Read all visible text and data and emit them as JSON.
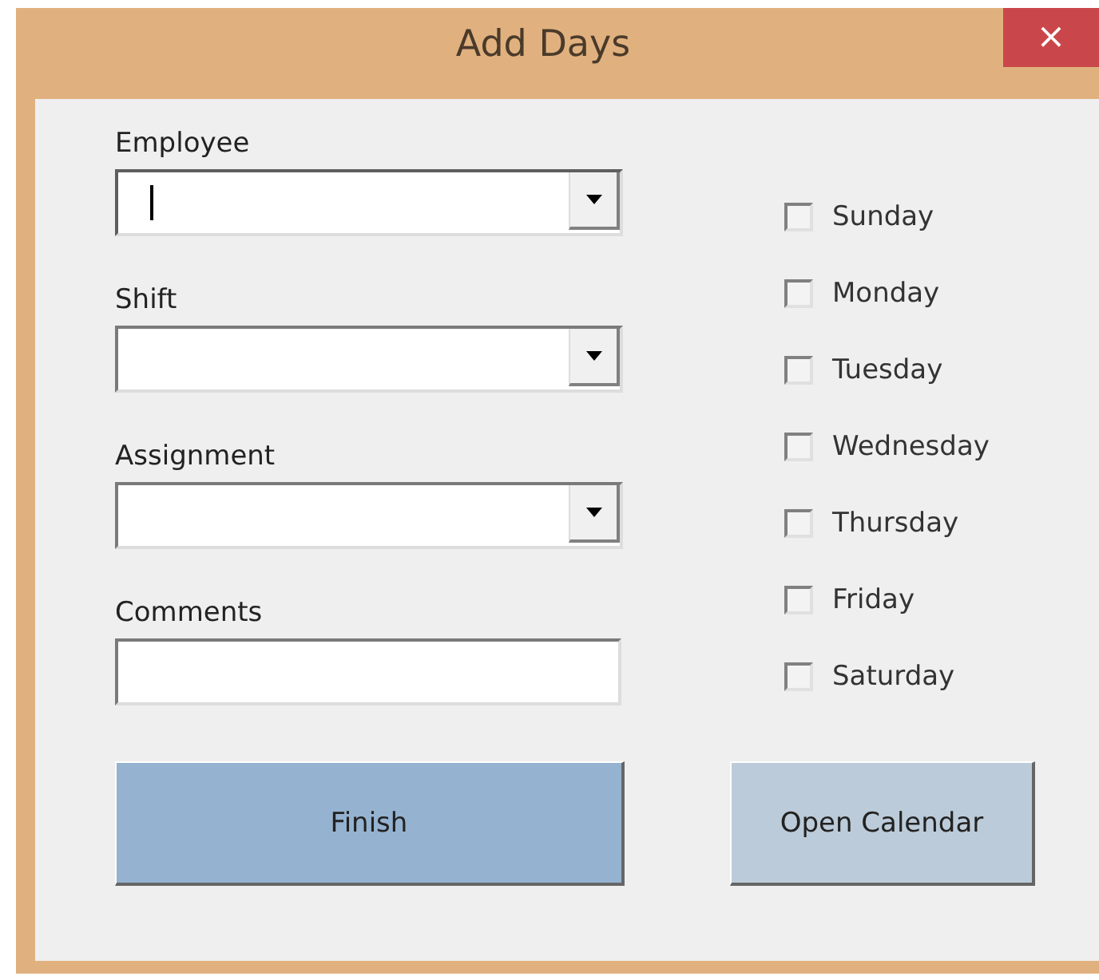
{
  "window": {
    "title": "Add Days",
    "close": "×"
  },
  "fields": [
    {
      "label": "Employee",
      "kind": "combo",
      "focused": true
    },
    {
      "label": "Shift",
      "kind": "combo",
      "focused": false
    },
    {
      "label": "Assignment",
      "kind": "combo",
      "focused": false
    },
    {
      "label": "Comments",
      "kind": "text",
      "focused": false
    }
  ],
  "days": [
    {
      "label": "Sunday",
      "checked": false
    },
    {
      "label": "Monday",
      "checked": false
    },
    {
      "label": "Tuesday",
      "checked": false
    },
    {
      "label": "Wednesday",
      "checked": false
    },
    {
      "label": "Thursday",
      "checked": false
    },
    {
      "label": "Friday",
      "checked": false
    },
    {
      "label": "Saturday",
      "checked": false
    }
  ],
  "buttons": [
    {
      "label": "Finish",
      "kind": "primary"
    },
    {
      "label": "Open Calendar",
      "kind": "secondary"
    }
  ]
}
